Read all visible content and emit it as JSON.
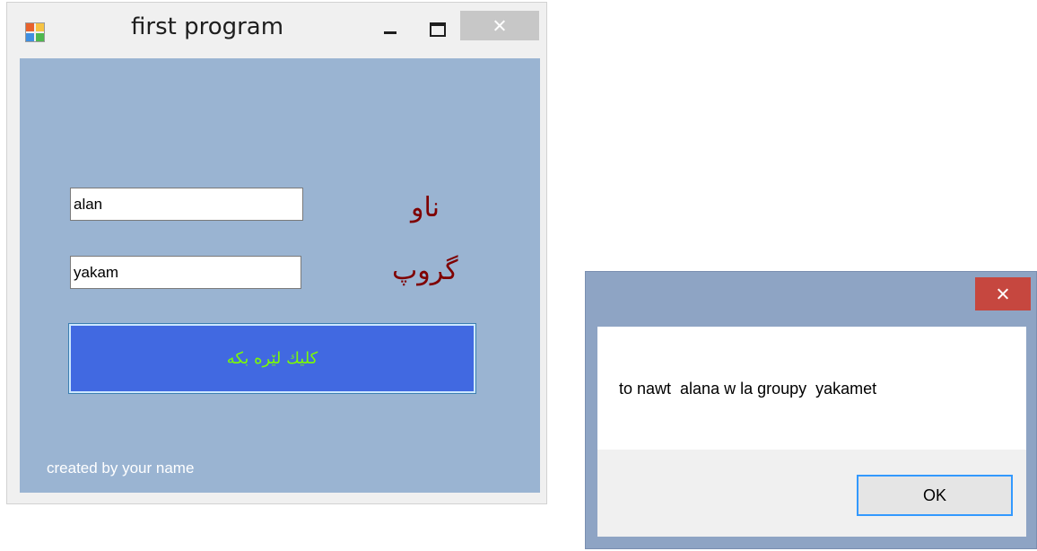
{
  "form": {
    "title": "first program",
    "icon": "windows-form-icon",
    "name_input": {
      "value": "alan"
    },
    "group_input": {
      "value": "yakam"
    },
    "name_label": "ناو",
    "group_label": "گروپ",
    "click_button_label": "كليك لێره بكه",
    "footer": "created by your name",
    "colors": {
      "client_bg": "#9ab4d2",
      "label_text": "#7f0000",
      "button_bg": "#4169e1",
      "button_text": "#7cfc00"
    }
  },
  "message_box": {
    "message": "to nawt  alana w la groupy  yakamet",
    "ok_label": "OK",
    "colors": {
      "frame": "#8ea4c4",
      "close_button": "#c6473f"
    }
  }
}
